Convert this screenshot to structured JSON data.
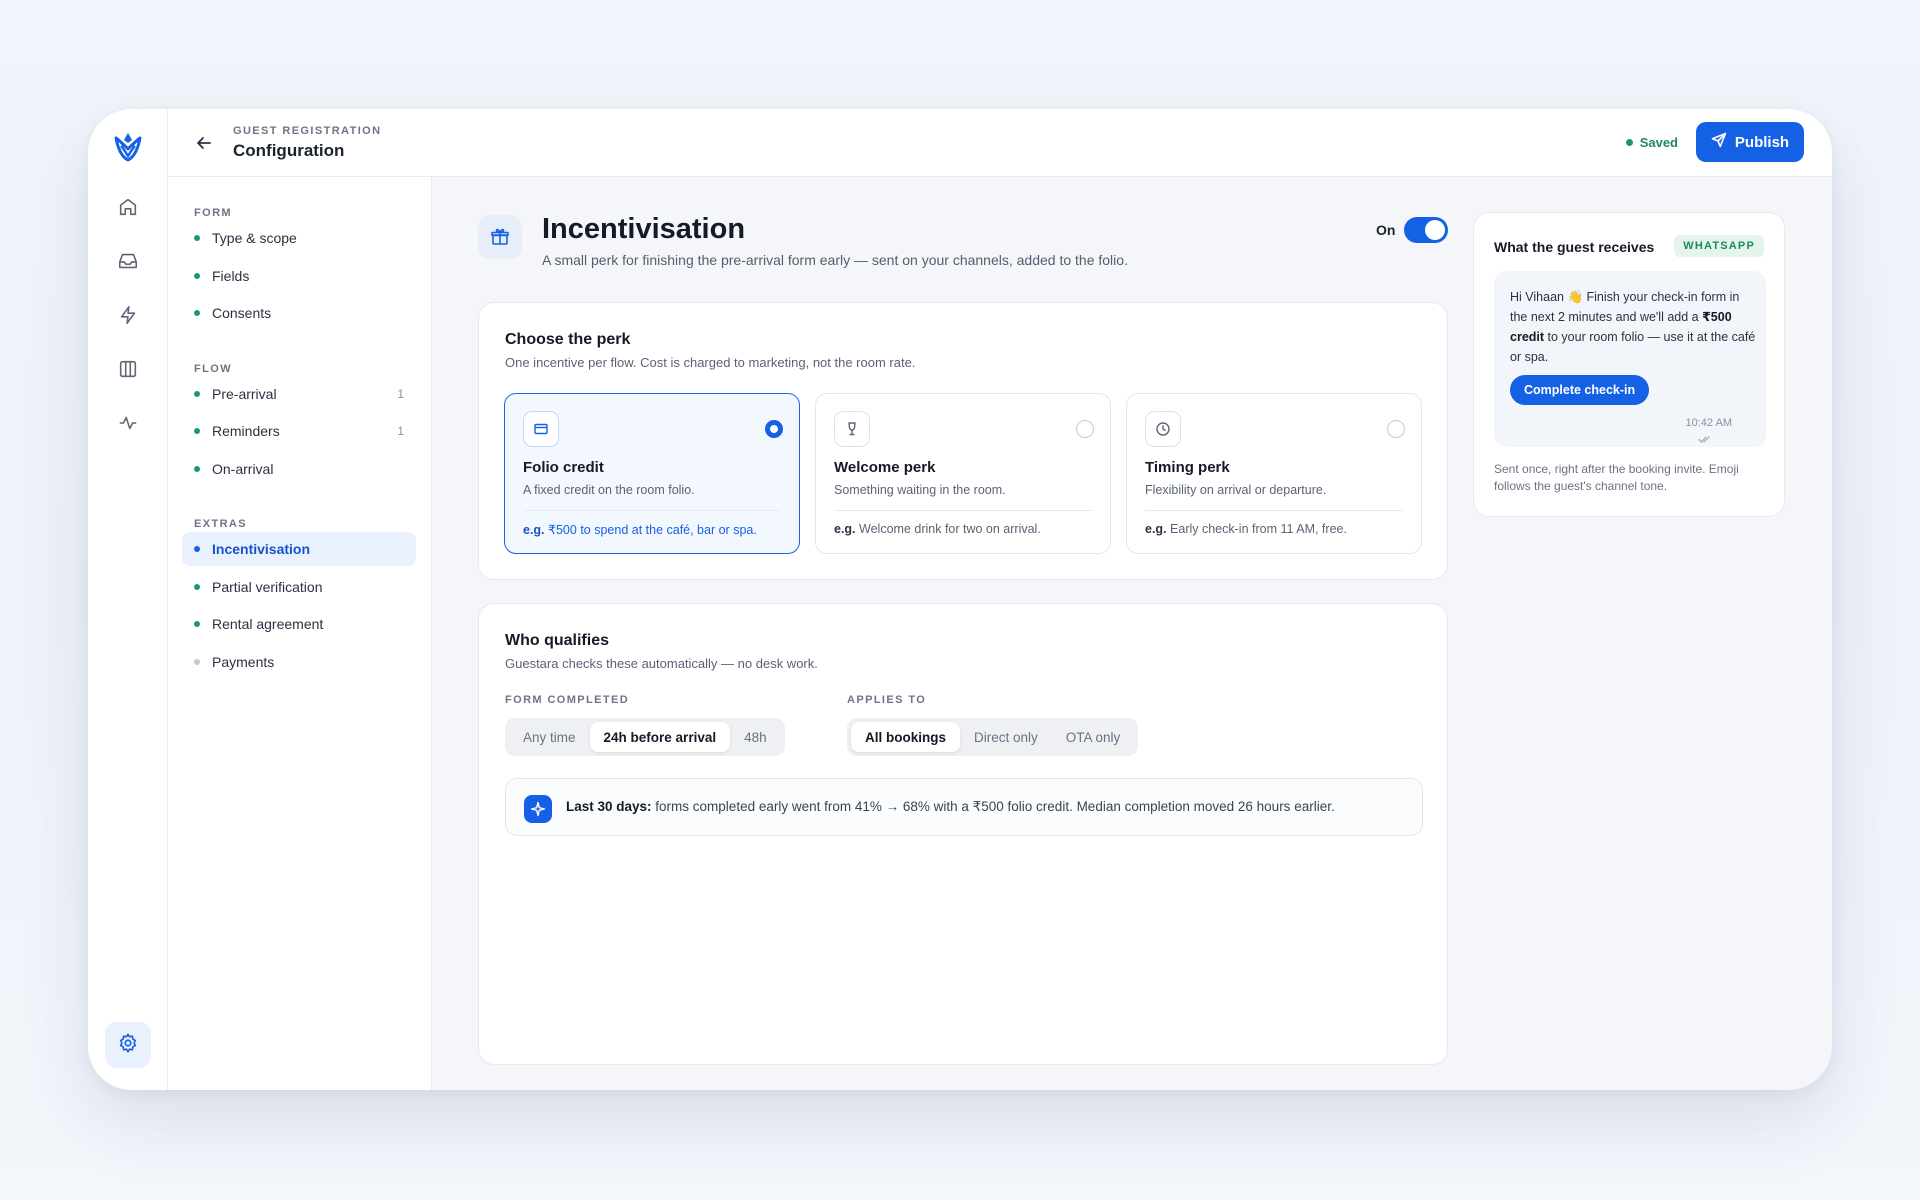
{
  "header": {
    "eyebrow": "GUEST REGISTRATION",
    "title": "Configuration",
    "saved_label": "Saved",
    "publish_label": "Publish"
  },
  "rail": {
    "icons": [
      "home-icon",
      "inbox-icon",
      "bolt-icon",
      "columns-icon",
      "activity-icon",
      "gear-icon"
    ]
  },
  "nav": {
    "sections": [
      {
        "label": "FORM",
        "items": [
          {
            "label": "Type & scope",
            "count": ""
          },
          {
            "label": "Fields",
            "count": ""
          },
          {
            "label": "Consents",
            "count": ""
          }
        ]
      },
      {
        "label": "FLOW",
        "items": [
          {
            "label": "Pre-arrival",
            "count": "1"
          },
          {
            "label": "Reminders",
            "count": "1"
          },
          {
            "label": "On-arrival",
            "count": ""
          }
        ]
      },
      {
        "label": "EXTRAS",
        "items": [
          {
            "label": "Incentivisation",
            "count": ""
          },
          {
            "label": "Partial verification",
            "count": ""
          },
          {
            "label": "Rental agreement",
            "count": ""
          },
          {
            "label": "Payments",
            "count": ""
          }
        ]
      }
    ],
    "active": "Incentivisation"
  },
  "page": {
    "title": "Incentivisation",
    "subtitle": "A small perk for finishing the pre-arrival form early — sent on your channels, added to the folio.",
    "toggle_label": "On",
    "toggle_on": true
  },
  "perk_card": {
    "title": "Choose the perk",
    "subtitle": "One incentive per flow. Cost is charged to marketing, not the room rate.",
    "options": [
      {
        "name": "Folio credit",
        "desc": "A fixed credit on the room folio.",
        "ex_prefix": "e.g.",
        "ex": "₹500 to spend at the café, bar or spa.",
        "selected": true,
        "icon": "card-icon"
      },
      {
        "name": "Welcome perk",
        "desc": "Something waiting in the room.",
        "ex_prefix": "e.g.",
        "ex": "Welcome drink for two on arrival.",
        "selected": false,
        "icon": "glass-icon"
      },
      {
        "name": "Timing perk",
        "desc": "Flexibility on arrival or departure.",
        "ex_prefix": "e.g.",
        "ex": "Early check-in from 11 AM, free.",
        "selected": false,
        "icon": "clock-icon"
      }
    ]
  },
  "qualify_card": {
    "title": "Who qualifies",
    "subtitle": "Guestara checks these automatically — no desk work.",
    "form_completed": {
      "label": "FORM COMPLETED",
      "options": [
        "Any time",
        "24h before arrival",
        "48h"
      ],
      "selected": "24h before arrival"
    },
    "applies_to": {
      "label": "APPLIES TO",
      "options": [
        "All bookings",
        "Direct only",
        "OTA only"
      ],
      "selected": "All bookings"
    },
    "insight": {
      "lead": "Last 30 days:",
      "text": " forms completed early went from 41% → 68% with a ₹500 folio credit. Median completion moved 26 hours earlier."
    }
  },
  "preview": {
    "title": "What the guest receives",
    "channel": "WHATSAPP",
    "message_a": "Hi Vihaan 👋 Finish your check-in form in the next 2 minutes and we'll add a ",
    "message_bold": "₹500 credit",
    "message_b": " to your room folio — use it at the café or spa.",
    "cta": "Complete check-in",
    "time": "10:42 AM",
    "footnote": "Sent once, right after the booking invite. Emoji follows the guest's channel tone."
  },
  "colors": {
    "accent": "#1561e6",
    "success": "#1d9a63",
    "bg": "#f4f6fa"
  }
}
